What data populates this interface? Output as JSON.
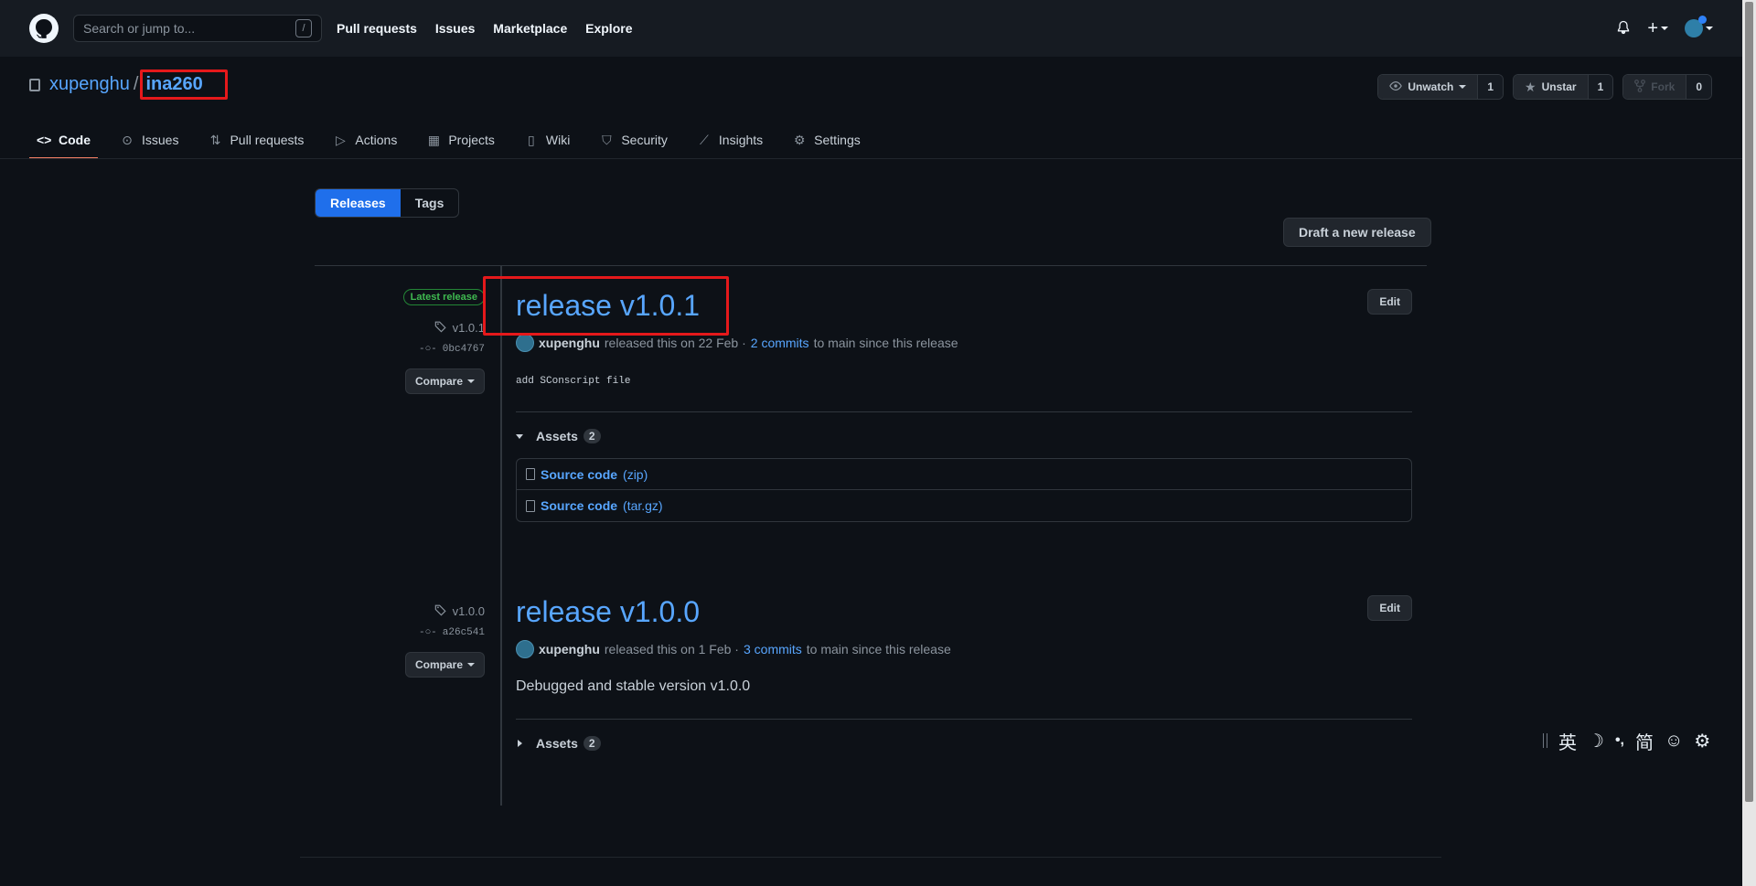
{
  "header": {
    "search_placeholder": "Search or jump to...",
    "search_key": "/",
    "nav": [
      "Pull requests",
      "Issues",
      "Marketplace",
      "Explore"
    ]
  },
  "repo": {
    "owner": "xupenghu",
    "separator": "/",
    "name": "ina260",
    "watch_label": "Unwatch",
    "watch_count": "1",
    "star_label": "Unstar",
    "star_count": "1",
    "fork_label": "Fork",
    "fork_count": "0"
  },
  "tabs": [
    {
      "label": "Code",
      "icon": "code-icon",
      "selected": true
    },
    {
      "label": "Issues",
      "icon": "issue-icon"
    },
    {
      "label": "Pull requests",
      "icon": "pull-request-icon"
    },
    {
      "label": "Actions",
      "icon": "play-icon"
    },
    {
      "label": "Projects",
      "icon": "project-icon"
    },
    {
      "label": "Wiki",
      "icon": "book-icon"
    },
    {
      "label": "Security",
      "icon": "shield-icon"
    },
    {
      "label": "Insights",
      "icon": "graph-icon"
    },
    {
      "label": "Settings",
      "icon": "gear-icon"
    }
  ],
  "subnav": {
    "releases": "Releases",
    "tags": "Tags"
  },
  "draft_button": "Draft a new release",
  "releases": [
    {
      "badge": "Latest release",
      "tag": "v1.0.1",
      "commit": "0bc4767",
      "compare": "Compare",
      "title": "release v1.0.1",
      "author": "xupenghu",
      "released_text": "released this on 22 Feb ·",
      "commits_link": "2 commits",
      "since_text": "to main since this release",
      "edit": "Edit",
      "body": "add SConscript file",
      "assets_label": "Assets",
      "assets_count": "2",
      "assets": [
        {
          "name": "Source code",
          "ext": "(zip)"
        },
        {
          "name": "Source code",
          "ext": "(tar.gz)"
        }
      ]
    },
    {
      "tag": "v1.0.0",
      "commit": "a26c541",
      "compare": "Compare",
      "title": "release v1.0.0",
      "author": "xupenghu",
      "released_text": "released this on 1 Feb ·",
      "commits_link": "3 commits",
      "since_text": "to main since this release",
      "edit": "Edit",
      "body": "Debugged and stable version v1.0.0",
      "assets_label": "Assets",
      "assets_count": "2"
    }
  ],
  "ime": {
    "lang": "英",
    "punct": "•,",
    "script": "简"
  }
}
